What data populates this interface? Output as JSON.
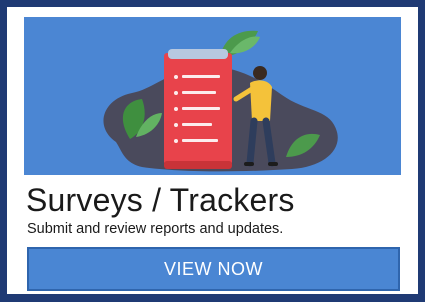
{
  "card": {
    "title": "Surveys / Trackers",
    "subtitle": "Submit and review reports and updates.",
    "cta_label": "VIEW NOW",
    "illustration": "clipboard-checklist-person-illustration"
  },
  "colors": {
    "frame": "#1f3a74",
    "illustration_bg": "#4b86d3",
    "button_bg": "#4a86d3",
    "clipboard": "#e8434b",
    "leaf": "#4c9a4c",
    "blob": "#4a4a5c"
  }
}
